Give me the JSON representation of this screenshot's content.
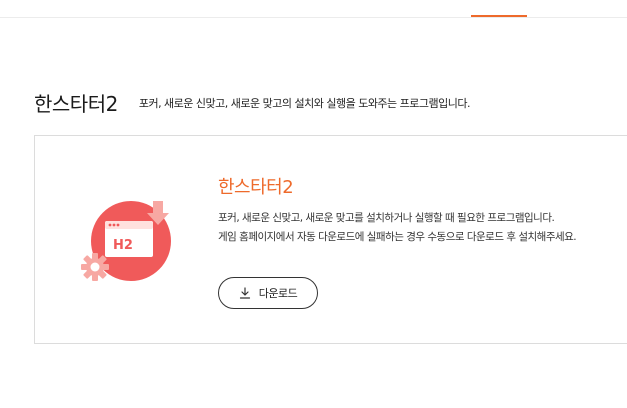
{
  "section": {
    "title": "한스타터2",
    "description": "포커, 새로운 신맞고, 새로운 맞고의 설치와 실행을 도와주는 프로그램입니다."
  },
  "product": {
    "name": "한스타터2",
    "logo_text": "H2",
    "logo_icon": "hanstarter2-logo-icon",
    "description_lines": [
      "포커, 새로운 신맞고, 새로운 맞고를 설치하거나 실행할 때 필요한 프로그램입니다.",
      "게임 홈페이지에서 자동 다운로드에 실패하는 경우 수동으로 다운로드 후 설치해주세요."
    ],
    "download_label": "다운로드",
    "download_icon": "download-icon"
  },
  "colors": {
    "accent": "#ee6a2b",
    "logo_red": "#f05a5a",
    "logo_pink": "#f7a8a3"
  }
}
